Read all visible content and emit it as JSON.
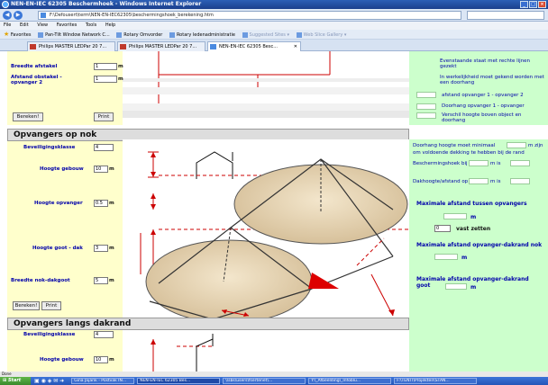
{
  "window": {
    "title": "NEN-EN-IEC 62305 Beschermhoek - Windows Internet Explorer"
  },
  "address": {
    "url": "F:\\Defousert\\term\\NEN-EN-IEC62305\\beschermingshoek_berekening.htm"
  },
  "menu": [
    "File",
    "Edit",
    "View",
    "Favorites",
    "Tools",
    "Help"
  ],
  "favorites": {
    "label": "Favorites",
    "items": [
      "Pan-Tilt Window Network C...",
      "Rotary Omvorder",
      "Rotary ledenadministratie",
      "Suggested Sites ▾",
      "Web Slice Gallery ▾"
    ]
  },
  "tabs": [
    "Philips MASTER LEDPar 20 7...",
    "Philips MASTER LEDPar 20 7...",
    "NEN-EN-IEC 62305 Besc..."
  ],
  "top_section": {
    "rows": [
      {
        "label": "Breedte afstakel",
        "value": "1",
        "unit": "m"
      },
      {
        "label": "Afstand obstakel - opvanger 2",
        "value": "1",
        "unit": "m"
      }
    ],
    "buttons": [
      "Bereken!",
      "Print"
    ],
    "green_texts": [
      "Evenstaande staat met rechte lijnen gezekt",
      "In werkelijkheid moet gekend worden met een doorhang",
      "afstand opvanger 1 - opvanger 2",
      "Doorhang opvanger 1 - opvanger",
      "Verschil hoogte boven object en doorhang"
    ]
  },
  "nok_section": {
    "title": "Opvangers op nok",
    "fields": [
      {
        "label": "Beveiligingsklasse",
        "value": "4",
        "unit": ""
      },
      {
        "label": "Hoogte gebouw",
        "value": "10",
        "unit": "m"
      },
      {
        "label": "Hoogte opvanger",
        "value": "0.5",
        "unit": "m"
      },
      {
        "label": "Hoogte goot - dak",
        "value": "3",
        "unit": "m"
      },
      {
        "label": "Breedte nok-dakgoot",
        "value": "5",
        "unit": "m"
      }
    ],
    "buttons": [
      "Bereken!",
      "Print"
    ],
    "green": {
      "line1": "Doorhang hoogte moet minimaal",
      "line1b": "m zijn",
      "line2": "om voldoende dekking te hebben bij de rand",
      "line3": "Beschermingshoek bij",
      "line3b": "m is",
      "line4": "Dakhoogte/afstand op",
      "line4b": "m is",
      "max_title": "Maximale afstand tussen opvangers",
      "max_unit": "m",
      "fix_value": "0",
      "fix_label": "vast zetten",
      "max_dakrand_title": "Maximale afstand opvanger-dakrand nok",
      "max_dakrand_unit": "m",
      "max_goot_title": "Maximale afstand opvanger-dakrand goot",
      "max_goot_unit": "m"
    }
  },
  "dakrand_section": {
    "title": "Opvangers langs dakrand",
    "fields": [
      {
        "label": "Beveiligingsklasse",
        "value": "4",
        "unit": ""
      },
      {
        "label": "Hoogte gebouw",
        "value": "10",
        "unit": "m"
      }
    ]
  },
  "status": {
    "text": "Done"
  },
  "taskbar": {
    "start": "Start",
    "items": [
      "Gina Jajarik - Postvak IN...",
      "NEN-EN-IEC 62305 Bes...",
      "\\\\sbs\\users\\fsertenet\\...",
      "Y:\\_Afbeelding\\_Infoblu...",
      "F:\\TENTI\\Projekten\\STAN..."
    ]
  },
  "colors": {
    "accent_red": "#cc0000",
    "green_panel": "#ccffcc",
    "yellow_panel": "#ffffcc",
    "label_blue": "#0000aa"
  }
}
